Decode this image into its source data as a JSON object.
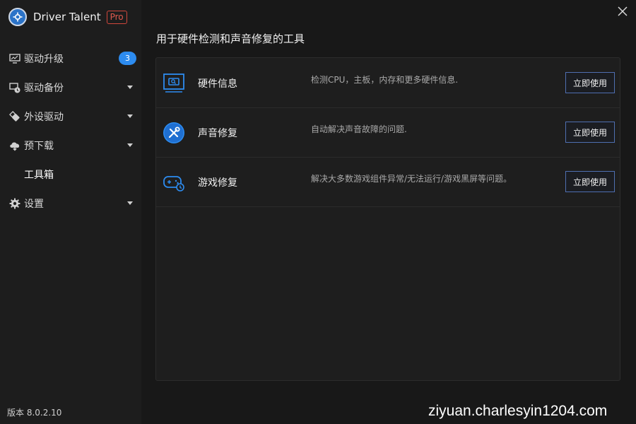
{
  "app": {
    "title": "Driver Talent",
    "badge": "Pro",
    "version": "版本 8.0.2.10",
    "accent": "#2d8cf0"
  },
  "sidebar": {
    "items": [
      {
        "label": "驱动升级",
        "icon": "monitor-icon",
        "badge": "3"
      },
      {
        "label": "驱动备份",
        "icon": "backup-icon",
        "expandable": true
      },
      {
        "label": "外设驱动",
        "icon": "usb-icon",
        "expandable": true
      },
      {
        "label": "预下载",
        "icon": "cloud-download-icon",
        "expandable": true
      },
      {
        "label": "工具箱",
        "icon": "",
        "selected": true
      },
      {
        "label": "设置",
        "icon": "gear-icon",
        "expandable": true
      }
    ]
  },
  "main": {
    "title": "用于硬件检测和声音修复的工具",
    "tools": [
      {
        "name": "硬件信息",
        "desc": "检测CPU，主板，内存和更多硬件信息.",
        "button": "立即使用",
        "icon": "hardware-info-icon"
      },
      {
        "name": "声音修复",
        "desc": "自动解决声音故障的问题.",
        "button": "立即使用",
        "icon": "sound-repair-icon"
      },
      {
        "name": "游戏修复",
        "desc": "解决大多数游戏组件异常/无法运行/游戏黑屏等问题。",
        "button": "立即使用",
        "icon": "game-repair-icon"
      }
    ]
  },
  "watermark": "ziyuan.charlesyin1204.com"
}
